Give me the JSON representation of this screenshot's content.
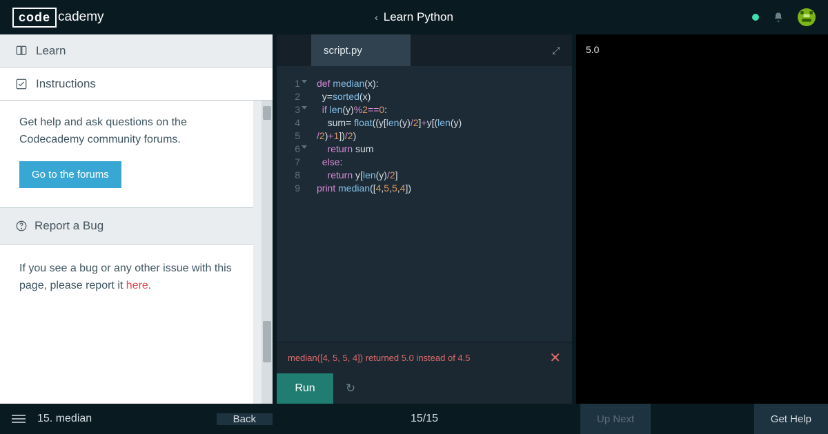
{
  "topbar": {
    "logo_box": "code",
    "logo_rest": "cademy",
    "title": "Learn Python"
  },
  "sidepanel": {
    "tab_learn": "Learn",
    "tab_instructions": "Instructions",
    "help_text": "Get help and ask questions on the Codecademy community forums.",
    "help_button": "Go to the forums",
    "bug_header": "Report a Bug",
    "bug_text_1": "If you see a bug or any other issue with this page, please report it ",
    "bug_here": "here",
    "bug_dot": "."
  },
  "editor": {
    "filename": "script.py",
    "gutter": [
      "1",
      "2",
      "3",
      "4",
      "5",
      "6",
      "7",
      "8",
      "9"
    ],
    "folds": [
      0,
      2,
      5
    ],
    "code_html": "<span class='kw'>def</span> <span class='fn'>median</span>(<span class='var'>x</span>):\n  <span class='var'>y</span>=<span class='bi'>sorted</span>(<span class='var'>x</span>)\n  <span class='kw'>if</span> <span class='bi'>len</span>(<span class='var'>y</span>)<span class='op'>%</span><span class='num'>2</span><span class='op'>==</span><span class='num'>0</span>:\n    <span class='var'>sum</span>= <span class='bi'>float</span>((<span class='var'>y</span>[<span class='bi'>len</span>(<span class='var'>y</span>)<span class='op'>/</span><span class='num'>2</span>]<span class='op'>+</span><span class='var'>y</span>[(<span class='bi'>len</span>(<span class='var'>y</span>)\n<span class='op'>/</span><span class='num'>2</span>)<span class='op'>+</span><span class='num'>1</span>])<span class='op'>/</span><span class='num'>2</span>)\n    <span class='kw'>return</span> <span class='var'>sum</span>\n  <span class='kw'>else</span>:\n    <span class='kw'>return</span> <span class='var'>y</span>[<span class='bi'>len</span>(<span class='var'>y</span>)<span class='op'>/</span><span class='num'>2</span>]\n<span class='kw'>print</span> <span class='pr'>median</span>([<span class='num'>4</span>,<span class='num'>5</span>,<span class='num'>5</span>,<span class='num'>4</span>])\n",
    "error": "median([4, 5, 5, 4]) returned 5.0 instead of 4.5",
    "run_label": "Run"
  },
  "output": {
    "text": "5.0"
  },
  "bottombar": {
    "crumb": "15. median",
    "back": "Back",
    "progress": "15/15",
    "upnext": "Up Next",
    "gethelp": "Get Help"
  }
}
